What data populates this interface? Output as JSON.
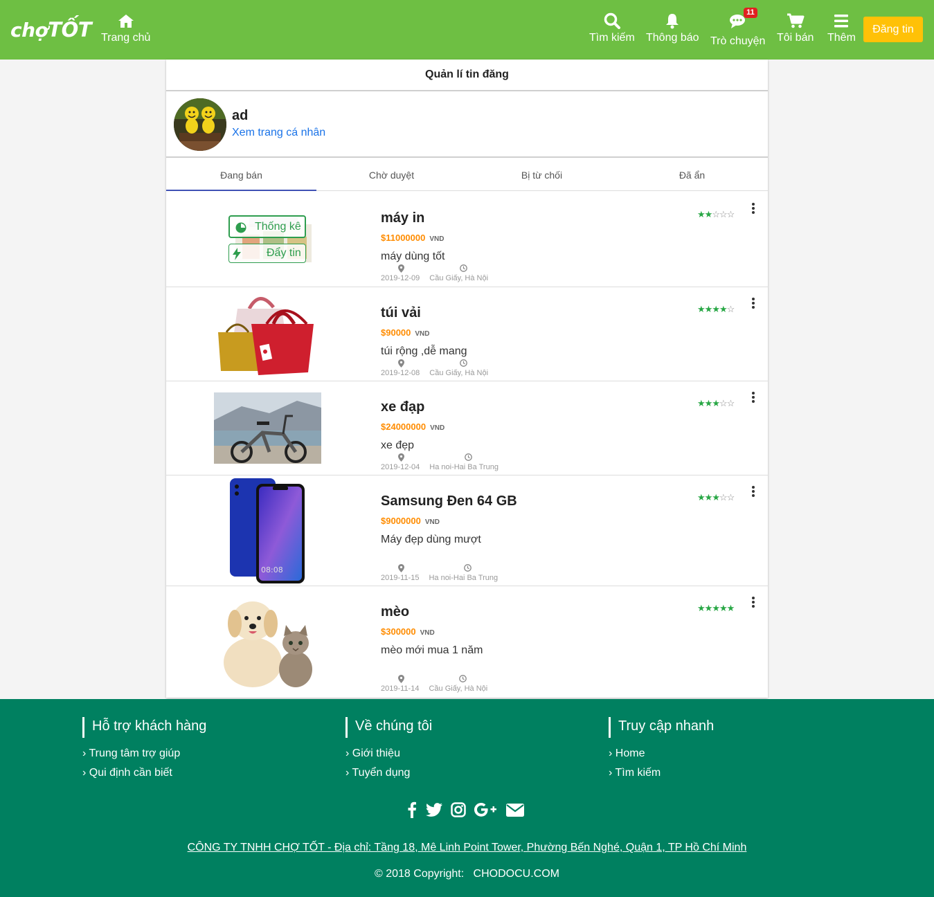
{
  "header": {
    "logo_prefix": "chợ",
    "logo_suffix": "TỐT",
    "nav": {
      "home": "Trang chủ",
      "search": "Tìm kiếm",
      "notify": "Thông báo",
      "chat": "Trò chuyện",
      "chat_badge": "11",
      "sell": "Tôi bán",
      "more": "Thêm"
    },
    "post_button": "Đăng tin"
  },
  "page": {
    "title": "Quản lí tin đăng"
  },
  "profile": {
    "name": "ad",
    "link": "Xem trang cá nhân"
  },
  "tabs": [
    "Đang bán",
    "Chờ duyệt",
    "Bị từ chối",
    "Đã ẩn"
  ],
  "overlay": {
    "stats": "Thống kê",
    "push": "Đẩy tin"
  },
  "listings": [
    {
      "title": "máy in",
      "price": "$11000000",
      "currency": "VND",
      "desc": "máy dùng tốt",
      "date": "2019-12-09",
      "location": "Cầu Giấy, Hà Nội",
      "rating": 2
    },
    {
      "title": "túi vải",
      "price": "$90000",
      "currency": "VND",
      "desc": "túi rộng ,dễ mang",
      "date": "2019-12-08",
      "location": "Cầu Giấy, Hà Nội",
      "rating": 4
    },
    {
      "title": "xe đạp",
      "price": "$24000000",
      "currency": "VND",
      "desc": "xe đẹp",
      "date": "2019-12-04",
      "location": "Ha noi-Hai Ba Trung",
      "rating": 3
    },
    {
      "title": "Samsung Đen 64 GB",
      "price": "$9000000",
      "currency": "VND",
      "desc": "Máy đẹp dùng mượt",
      "date": "2019-11-15",
      "location": "Ha noi-Hai Ba Trung",
      "rating": 3
    },
    {
      "title": "mèo",
      "price": "$300000",
      "currency": "VND",
      "desc": "mèo mới mua 1 năm",
      "date": "2019-11-14",
      "location": "Cầu Giấy, Hà Nội",
      "rating": 5
    }
  ],
  "phone_time": "08:08",
  "footer": {
    "col1": {
      "title": "Hỗ trợ khách hàng",
      "links": [
        "Trung tâm trợ giúp",
        "Qui định cần biết"
      ]
    },
    "col2": {
      "title": "Về chúng tôi",
      "links": [
        "Giới thiệu",
        "Tuyển dụng"
      ]
    },
    "col3": {
      "title": "Truy cập nhanh",
      "links": [
        "Home",
        "Tìm kiếm"
      ]
    },
    "social_icons": [
      "facebook-icon",
      "twitter-icon",
      "instagram-icon",
      "google-plus-icon",
      "envelope-icon"
    ],
    "company": "CÔNG TY TNHH CHỢ TỐT - Địa chỉ: Tầng 18, Mê Linh Point Tower, Phường Bến Nghé, Quận 1, TP Hồ Chí Minh",
    "copyright_prefix": "© 2018 Copyright:",
    "copyright_site": "CHODOCU.COM"
  },
  "colors": {
    "brand": "#6ebf43",
    "footer": "#008060",
    "accent": "#ffc107",
    "price": "#ff8c00",
    "star": "#28a745",
    "tab_active": "#3f51b5"
  }
}
